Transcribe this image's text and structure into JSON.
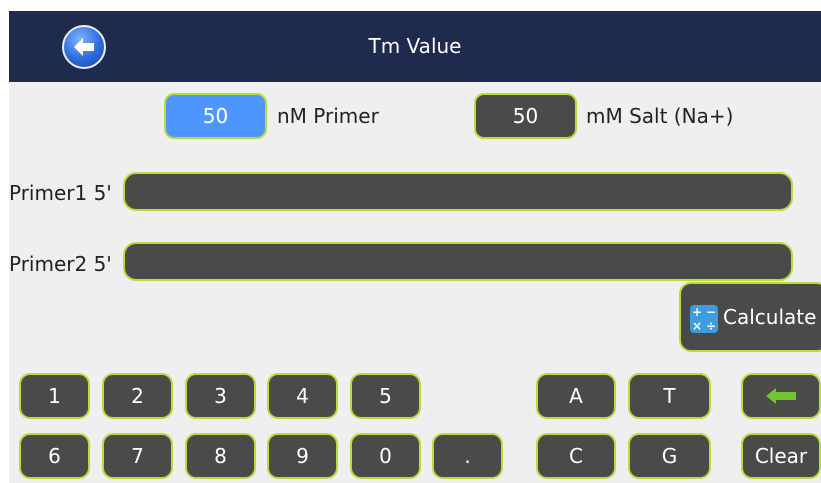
{
  "header": {
    "title": "Tm Value",
    "back_icon": "back-arrow-icon"
  },
  "concentrations": {
    "primer_value": "50",
    "primer_unit": "nM Primer",
    "salt_value": "50",
    "salt_unit": "mM Salt (Na+)"
  },
  "primers": [
    {
      "label": "Primer1 5'",
      "sequence": ""
    },
    {
      "label": "Primer2 5'",
      "sequence": ""
    }
  ],
  "calculate": {
    "label": "Calculate",
    "icon": "calculator-icon"
  },
  "keypad": {
    "digits_row1": [
      "1",
      "2",
      "3",
      "4",
      "5"
    ],
    "digits_row2": [
      "6",
      "7",
      "8",
      "9",
      "0",
      "."
    ],
    "bases_row1": [
      "A",
      "T"
    ],
    "bases_row2": [
      "C",
      "G"
    ],
    "backspace_icon": "backspace-arrow-icon",
    "clear": "Clear"
  },
  "colors": {
    "header_bg": "#1e2a4e",
    "panel_bg": "#efefef",
    "button_bg": "#4a4a48",
    "button_border": "#b7dd3c",
    "active_field": "#4d96ff",
    "backspace_arrow": "#6fc52b"
  }
}
